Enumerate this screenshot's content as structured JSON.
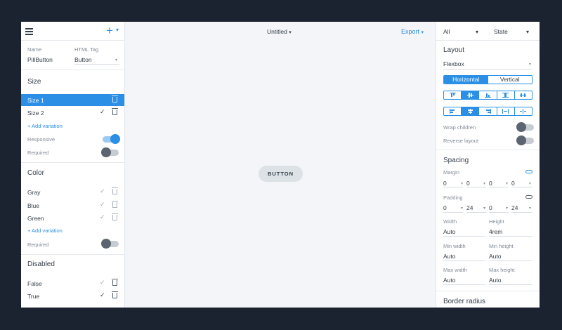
{
  "left": {
    "name_label": "Name",
    "tag_label": "HTML Tag",
    "name_value": "PillButton",
    "tag_value": "Button",
    "size": {
      "title": "Size",
      "items": [
        {
          "label": "Size 1",
          "selected": true
        },
        {
          "label": "Size 2",
          "selected": false
        }
      ],
      "add_label": "+ Add variation",
      "responsive_label": "Responsive",
      "required_label": "Required"
    },
    "color": {
      "title": "Color",
      "items": [
        {
          "label": "Gray"
        },
        {
          "label": "Blue"
        },
        {
          "label": "Green"
        }
      ],
      "add_label": "+ Add variation",
      "required_label": "Required"
    },
    "disabled": {
      "title": "Disabled",
      "items": [
        {
          "label": "False"
        },
        {
          "label": "True"
        }
      ]
    }
  },
  "toolbar": {
    "doc_name": "Untitled",
    "export_label": "Export"
  },
  "canvas": {
    "button_label": "BUTTON"
  },
  "right": {
    "filter_all": "All",
    "filter_state": "State",
    "layout": {
      "title": "Layout",
      "display": "Flexbox",
      "dir_horizontal": "Horizontal",
      "dir_vertical": "Vertical",
      "wrap_label": "Wrap children",
      "reverse_label": "Reverse layout"
    },
    "spacing": {
      "title": "Spacing",
      "margin_label": "Margin",
      "margin": [
        "0",
        "0",
        "0",
        "0"
      ],
      "padding_label": "Padding",
      "padding": [
        "0",
        "24",
        "0",
        "24"
      ],
      "width_label": "Width",
      "width": "Auto",
      "height_label": "Height",
      "height": "4rem",
      "min_width_label": "Min width",
      "min_width": "Auto",
      "min_height_label": "Min height",
      "min_height": "Auto",
      "max_width_label": "Max width",
      "max_width": "Auto",
      "max_height_label": "Max height",
      "max_height": "Auto"
    },
    "border_radius_title": "Border radius"
  },
  "colors": {
    "accent": "#2b8fe6",
    "background": "#1b2330",
    "canvas": "#f3f5f8"
  }
}
